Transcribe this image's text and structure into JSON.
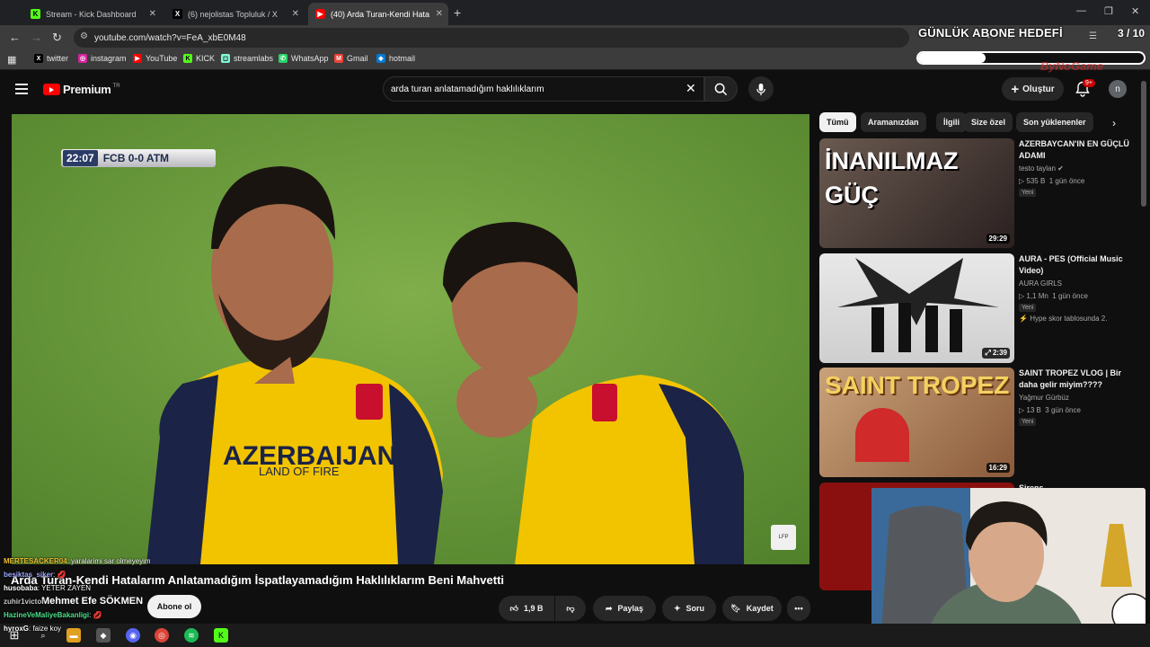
{
  "browser": {
    "tabs": [
      {
        "label": "Stream - Kick Dashboard",
        "icon": "kick-icon",
        "active": false
      },
      {
        "label": "(6) nejolistas Topluluk / X",
        "icon": "x-icon",
        "active": false
      },
      {
        "label": "(40) Arda Turan-Kendi Hata",
        "icon": "youtube-icon",
        "active": true
      }
    ],
    "url": "youtube.com/watch?v=FeA_xbE0M48",
    "bookmarks": [
      {
        "label": "twitter",
        "color": "#000000",
        "glyph": "X"
      },
      {
        "label": "instagram",
        "color": "#d6249f",
        "glyph": "◎"
      },
      {
        "label": "YouTube",
        "color": "#ff0000",
        "glyph": "▶"
      },
      {
        "label": "KICK",
        "color": "#53fc18",
        "glyph": "K"
      },
      {
        "label": "streamlabs",
        "color": "#80f5d2",
        "glyph": "◻"
      },
      {
        "label": "WhatsApp",
        "color": "#25d366",
        "glyph": "✆"
      },
      {
        "label": "Gmail",
        "color": "#ea4335",
        "glyph": "M"
      },
      {
        "label": "hotmail",
        "color": "#0078d4",
        "glyph": "◈"
      }
    ]
  },
  "overlay": {
    "goal_label": "GÜNLÜK ABONE HEDEFİ",
    "goal_count": "3 / 10",
    "goal_progress": 0.3,
    "watermark": "ByNoGame"
  },
  "youtube": {
    "brand": "Premium",
    "brand_sup": "TR",
    "search_query": "arda turan anlatamadığım haklılıklarım",
    "create_label": "Oluştur",
    "notif_count": "9+",
    "avatar_letter": "n",
    "video": {
      "title": "Arda Turan-Kendi Hatalarım Anlatamadığım İspatlayamadığım Haklılıklarım Beni Mahvetti",
      "channel": "Mehmet Efe SÖKMEN",
      "subscribe_label": "Abone ol",
      "likes": "1,9 B",
      "share_label": "Paylaş",
      "ask_label": "Soru",
      "save_label": "Kaydet",
      "score_time": "22:07",
      "score_text": "FCB 0-0 ATM",
      "shirt_text": "AZERBAIJAN",
      "shirt_sub": "LAND OF FIRE"
    },
    "chips": [
      "Tümü",
      "Aramanızdan",
      "İlgili",
      "Size özel",
      "Son yüklenenler"
    ],
    "recommendations": [
      {
        "title": "AZERBAYCAN'IN EN GÜÇLÜ ADAMI",
        "channel": "testo taylan ✔",
        "views": "535 B",
        "age": "1 gün önce",
        "badge": "Yeni",
        "extra": "",
        "duration": "29:29",
        "thumb_text": "İNANILMAZ GÜÇ"
      },
      {
        "title": "AURA - PES (Official Music Video)",
        "channel": "AURA GIRLS",
        "views": "1,1 Mn",
        "age": "1 gün önce",
        "badge": "Yeni",
        "extra": "Hype skor tablosunda 2.",
        "duration": "2:39",
        "thumb_text": ""
      },
      {
        "title": "SAINT TROPEZ VLOG | Bir daha gelir miyim????",
        "channel": "Yağmur Gürbüz",
        "views": "13 B",
        "age": "3 gün önce",
        "badge": "Yeni",
        "extra": "",
        "duration": "16:29",
        "thumb_text": "SAINT TROPEZ"
      },
      {
        "title": "Sirens",
        "channel": "",
        "views": "",
        "age": "",
        "badge": "",
        "extra": "",
        "duration": "",
        "thumb_text": ""
      }
    ]
  },
  "chat": [
    {
      "name": "MERTESACKER04",
      "msg": ": yaralarimi sar olmeyeyim"
    },
    {
      "name": "besiktas_siker",
      "msg": ": 💋"
    },
    {
      "name": "husobaba",
      "msg": ": YETER ZAYEN"
    },
    {
      "name": "zuhir1victor",
      "msg": ""
    },
    {
      "name": "HazineVeMaliyeBakanligi",
      "msg": ": 💋"
    },
    {
      "name": "hyroxG",
      "msg": ": faize koy"
    }
  ]
}
